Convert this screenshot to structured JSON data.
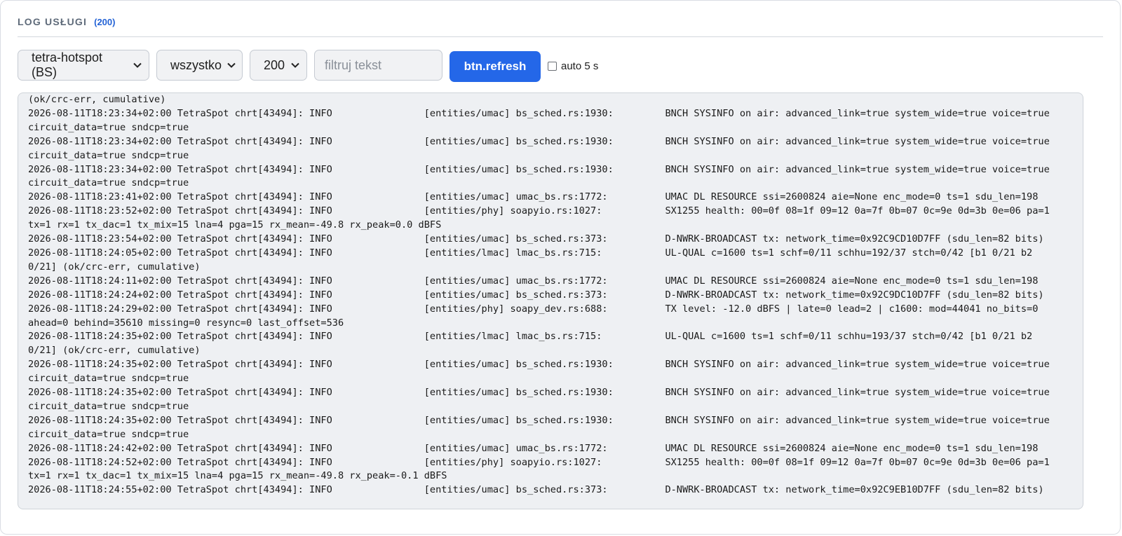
{
  "header": {
    "title": "LOG USŁUGI",
    "count": "(200)"
  },
  "controls": {
    "service_select": "tetra-hotspot (BS)",
    "level_select": "wszystko",
    "count_select": "200",
    "filter_placeholder": "filtruj tekst",
    "refresh_label": "btn.refresh",
    "auto_label": "auto 5 s"
  },
  "log": {
    "lines": [
      "(ok/crc-err, cumulative)",
      "2026-08-11T18:23:34+02:00 TetraSpot chrt[43494]: INFO                [entities/umac] bs_sched.rs:1930:         BNCH SYSINFO on air: advanced_link=true system_wide=true voice=true",
      "circuit_data=true sndcp=true",
      "2026-08-11T18:23:34+02:00 TetraSpot chrt[43494]: INFO                [entities/umac] bs_sched.rs:1930:         BNCH SYSINFO on air: advanced_link=true system_wide=true voice=true",
      "circuit_data=true sndcp=true",
      "2026-08-11T18:23:34+02:00 TetraSpot chrt[43494]: INFO                [entities/umac] bs_sched.rs:1930:         BNCH SYSINFO on air: advanced_link=true system_wide=true voice=true",
      "circuit_data=true sndcp=true",
      "2026-08-11T18:23:41+02:00 TetraSpot chrt[43494]: INFO                [entities/umac] umac_bs.rs:1772:          UMAC DL RESOURCE ssi=2600824 aie=None enc_mode=0 ts=1 sdu_len=198",
      "2026-08-11T18:23:52+02:00 TetraSpot chrt[43494]: INFO                [entities/phy] soapyio.rs:1027:           SX1255 health: 00=0f 08=1f 09=12 0a=7f 0b=07 0c=9e 0d=3b 0e=06 pa=1",
      "tx=1 rx=1 tx_dac=1 tx_mix=15 lna=4 pga=15 rx_mean=-49.8 rx_peak=0.0 dBFS",
      "2026-08-11T18:23:54+02:00 TetraSpot chrt[43494]: INFO                [entities/umac] bs_sched.rs:373:          D-NWRK-BROADCAST tx: network_time=0x92C9CD10D7FF (sdu_len=82 bits)",
      "2026-08-11T18:24:05+02:00 TetraSpot chrt[43494]: INFO                [entities/lmac] lmac_bs.rs:715:           UL-QUAL c=1600 ts=1 schf=0/11 schhu=192/37 stch=0/42 [b1 0/21 b2",
      "0/21] (ok/crc-err, cumulative)",
      "2026-08-11T18:24:11+02:00 TetraSpot chrt[43494]: INFO                [entities/umac] umac_bs.rs:1772:          UMAC DL RESOURCE ssi=2600824 aie=None enc_mode=0 ts=1 sdu_len=198",
      "2026-08-11T18:24:24+02:00 TetraSpot chrt[43494]: INFO                [entities/umac] bs_sched.rs:373:          D-NWRK-BROADCAST tx: network_time=0x92C9DC10D7FF (sdu_len=82 bits)",
      "2026-08-11T18:24:29+02:00 TetraSpot chrt[43494]: INFO                [entities/phy] soapy_dev.rs:688:          TX level: -12.0 dBFS | late=0 lead=2 | c1600: mod=44041 no_bits=0",
      "ahead=0 behind=35610 missing=0 resync=0 last_offset=536",
      "2026-08-11T18:24:35+02:00 TetraSpot chrt[43494]: INFO                [entities/lmac] lmac_bs.rs:715:           UL-QUAL c=1600 ts=1 schf=0/11 schhu=193/37 stch=0/42 [b1 0/21 b2",
      "0/21] (ok/crc-err, cumulative)",
      "2026-08-11T18:24:35+02:00 TetraSpot chrt[43494]: INFO                [entities/umac] bs_sched.rs:1930:         BNCH SYSINFO on air: advanced_link=true system_wide=true voice=true",
      "circuit_data=true sndcp=true",
      "2026-08-11T18:24:35+02:00 TetraSpot chrt[43494]: INFO                [entities/umac] bs_sched.rs:1930:         BNCH SYSINFO on air: advanced_link=true system_wide=true voice=true",
      "circuit_data=true sndcp=true",
      "2026-08-11T18:24:35+02:00 TetraSpot chrt[43494]: INFO                [entities/umac] bs_sched.rs:1930:         BNCH SYSINFO on air: advanced_link=true system_wide=true voice=true",
      "circuit_data=true sndcp=true",
      "2026-08-11T18:24:42+02:00 TetraSpot chrt[43494]: INFO                [entities/umac] umac_bs.rs:1772:          UMAC DL RESOURCE ssi=2600824 aie=None enc_mode=0 ts=1 sdu_len=198",
      "2026-08-11T18:24:52+02:00 TetraSpot chrt[43494]: INFO                [entities/phy] soapyio.rs:1027:           SX1255 health: 00=0f 08=1f 09=12 0a=7f 0b=07 0c=9e 0d=3b 0e=06 pa=1",
      "tx=1 rx=1 tx_dac=1 tx_mix=15 lna=4 pga=15 rx_mean=-49.8 rx_peak=-0.1 dBFS",
      "2026-08-11T18:24:55+02:00 TetraSpot chrt[43494]: INFO                [entities/umac] bs_sched.rs:373:          D-NWRK-BROADCAST tx: network_time=0x92C9EB10D7FF (sdu_len=82 bits)"
    ]
  },
  "colors": {
    "accent": "#2467e8",
    "count": "#2463d6",
    "title": "#5f6b7a",
    "log_bg": "#eef0f3"
  }
}
